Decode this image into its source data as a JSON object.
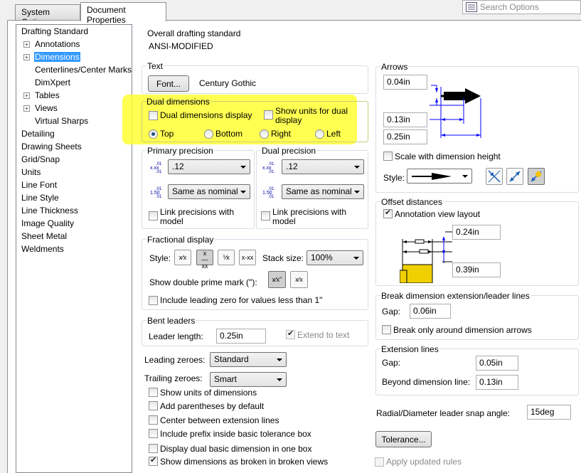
{
  "tabs": {
    "system_options": "System Options",
    "document_properties": "Document Properties"
  },
  "search": {
    "placeholder": "Search Options"
  },
  "tree": {
    "items": [
      {
        "label": "Drafting Standard"
      },
      {
        "label": "Annotations"
      },
      {
        "label": "Dimensions"
      },
      {
        "label": "Centerlines/Center Marks"
      },
      {
        "label": "DimXpert"
      },
      {
        "label": "Tables"
      },
      {
        "label": "Views"
      },
      {
        "label": "Virtual Sharps"
      },
      {
        "label": "Detailing"
      },
      {
        "label": "Drawing Sheets"
      },
      {
        "label": "Grid/Snap"
      },
      {
        "label": "Units"
      },
      {
        "label": "Line Font"
      },
      {
        "label": "Line Style"
      },
      {
        "label": "Line Thickness"
      },
      {
        "label": "Image Quality"
      },
      {
        "label": "Sheet Metal"
      },
      {
        "label": "Weldments"
      }
    ]
  },
  "overall": {
    "title": "Overall drafting standard",
    "value": "ANSI-MODIFIED"
  },
  "text_group": {
    "title": "Text",
    "font_button": "Font...",
    "font_name": "Century Gothic"
  },
  "dual_dims": {
    "title": "Dual dimensions",
    "display_label": "Dual dimensions display",
    "show_units_label_1": "Show units for dual",
    "show_units_label_2": "display",
    "positions": [
      "Top",
      "Bottom",
      "Right",
      "Left"
    ],
    "selected": "Top",
    "highlight_color": "#ffff33"
  },
  "primary_precision": {
    "title": "Primary precision",
    "value": ".12",
    "tolerance": "Same as nominal",
    "link_label_1": "Link precisions with",
    "link_label_2": "model"
  },
  "dual_precision": {
    "title": "Dual precision",
    "value": ".12",
    "tolerance": "Same as nominal",
    "link_label_1": "Link precisions with",
    "link_label_2": "model"
  },
  "fractional": {
    "title": "Fractional display",
    "style_label": "Style:",
    "stack_label": "Stack size:",
    "stack_value": "100%",
    "double_prime_label": "Show double prime mark (\"):",
    "leading_zero_label": "Include leading zero for values less than 1\""
  },
  "bent_leaders": {
    "title": "Bent leaders",
    "length_label": "Leader length:",
    "length_value": "0.25in",
    "extend_label": "Extend to text"
  },
  "leading_zeroes": {
    "label": "Leading zeroes:",
    "value": "Standard"
  },
  "trailing_zeroes": {
    "label": "Trailing zeroes:",
    "value": "Smart"
  },
  "options": {
    "show_units": "Show units of dimensions",
    "add_parentheses": "Add parentheses by default",
    "center_between": "Center between extension lines",
    "include_prefix": "Include prefix inside basic tolerance box",
    "display_dual_basic": "Display dual basic dimension in one box",
    "show_broken": "Show dimensions as broken in broken views"
  },
  "arrows": {
    "title": "Arrows",
    "height": "0.04in",
    "width": "0.13in",
    "length": "0.25in",
    "scale_label": "Scale with dimension height",
    "style_label": "Style:"
  },
  "offset": {
    "title": "Offset distances",
    "annotation_label": "Annotation view layout",
    "top_value": "0.24in",
    "bottom_value": "0.39in"
  },
  "break_dim": {
    "title": "Break dimension extension/leader lines",
    "gap_label": "Gap:",
    "gap_value": "0.06in",
    "only_arrows_label": "Break only around dimension arrows"
  },
  "extension": {
    "title": "Extension lines",
    "gap_label": "Gap:",
    "gap_value": "0.05in",
    "beyond_label": "Beyond dimension line:",
    "beyond_value": "0.13in"
  },
  "radial": {
    "label": "Radial/Diameter leader snap angle:",
    "value": "15deg"
  },
  "tolerance_button": "Tolerance...",
  "apply_rules_label": "Apply updated rules"
}
